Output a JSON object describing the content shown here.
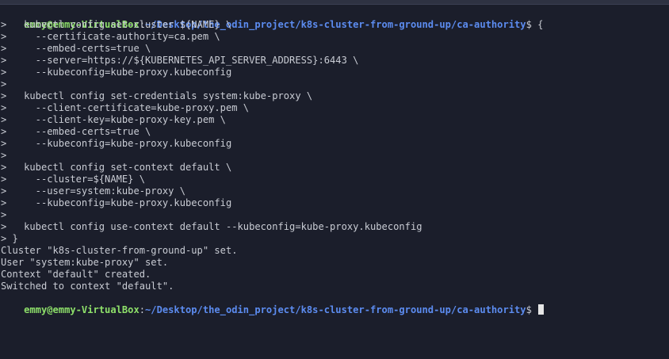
{
  "prompt": {
    "user_host": "emmy@emmy-VirtualBox",
    "separator": ":",
    "path": "~/Desktop/the_odin_project/k8s-cluster-from-ground-up/ca-authority",
    "suffix": "$ "
  },
  "first_command": "{",
  "continuation_lines": [
    ">   kubectl config set-cluster ${NAME} \\",
    ">     --certificate-authority=ca.pem \\",
    ">     --embed-certs=true \\",
    ">     --server=https://${KUBERNETES_API_SERVER_ADDRESS}:6443 \\",
    ">     --kubeconfig=kube-proxy.kubeconfig",
    ">",
    ">   kubectl config set-credentials system:kube-proxy \\",
    ">     --client-certificate=kube-proxy.pem \\",
    ">     --client-key=kube-proxy-key.pem \\",
    ">     --embed-certs=true \\",
    ">     --kubeconfig=kube-proxy.kubeconfig",
    ">",
    ">   kubectl config set-context default \\",
    ">     --cluster=${NAME} \\",
    ">     --user=system:kube-proxy \\",
    ">     --kubeconfig=kube-proxy.kubeconfig",
    ">",
    ">   kubectl config use-context default --kubeconfig=kube-proxy.kubeconfig",
    "> }"
  ],
  "output_lines": [
    "Cluster \"k8s-cluster-from-ground-up\" set.",
    "User \"system:kube-proxy\" set.",
    "Context \"default\" created.",
    "Switched to context \"default\"."
  ]
}
